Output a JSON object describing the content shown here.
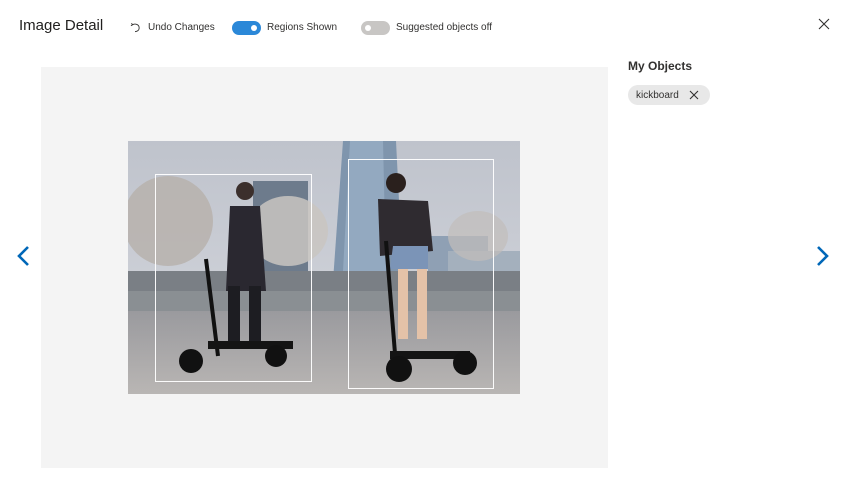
{
  "header": {
    "title": "Image Detail",
    "undo_label": "Undo Changes",
    "regions_toggle": {
      "label": "Regions Shown",
      "on": true
    },
    "suggested_toggle": {
      "label": "Suggested objects off",
      "on": false
    },
    "close_icon": "close-icon"
  },
  "viewer": {
    "photo_description_icon": "image",
    "regions": [
      {
        "label": "person-left"
      },
      {
        "label": "person-right"
      }
    ],
    "prev_icon": "chevron-left-icon",
    "next_icon": "chevron-right-icon",
    "accent_color": "#0067b8"
  },
  "side_panel": {
    "title": "My Objects",
    "tags": [
      {
        "label": "kickboard",
        "remove_icon": "close-icon"
      }
    ]
  }
}
